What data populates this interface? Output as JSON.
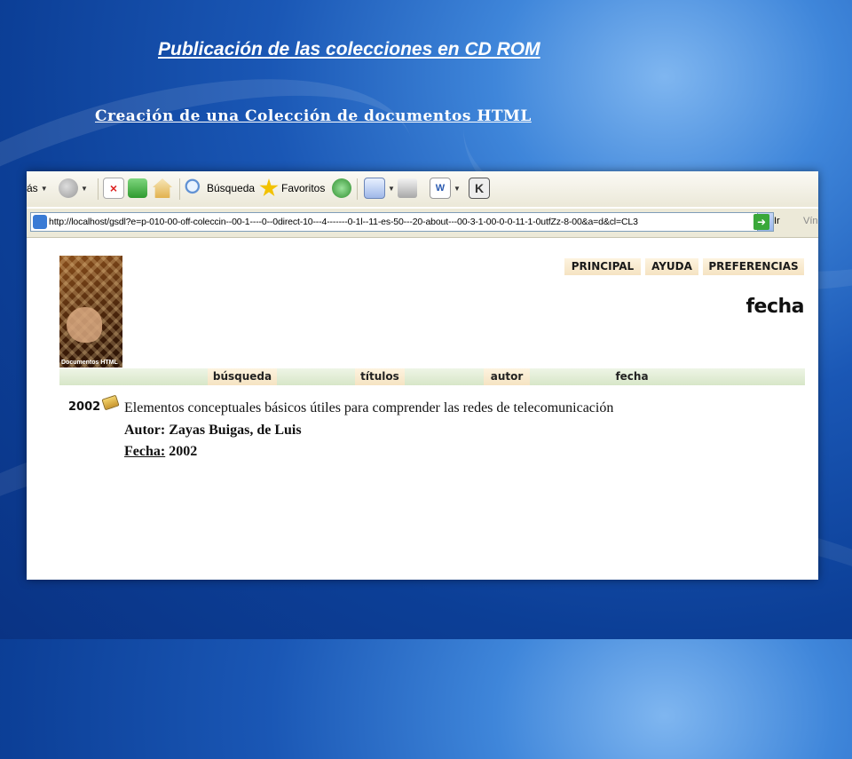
{
  "slide": {
    "title": "Publicación de las colecciones en CD ROM",
    "subtitle": "Creación de una Colección de documentos  HTML"
  },
  "browser": {
    "toolbar": {
      "back_fragment": "ás",
      "search_label": "Búsqueda",
      "favorites_label": "Favoritos"
    },
    "address": "http://localhost/gsdl?e=p-010-00-off-coleccin--00-1----0--0direct-10---4-------0-1l--11-es-50---20-about---00-3-1-00-0-0-11-1-0utfZz-8-00&a=d&cl=CL3",
    "go_label": "Ir",
    "links_label": "Vínc"
  },
  "page": {
    "logo_text": "Documentos HTML",
    "top_nav": [
      "PRINCIPAL",
      "AYUDA",
      "PREFERENCIAS"
    ],
    "heading": "fecha",
    "nav_tabs": [
      "búsqueda",
      "títulos",
      "autor",
      "fecha"
    ],
    "entry": {
      "year": "2002",
      "title": "Elementos conceptuales básicos útiles para comprender las redes de telecomunicación",
      "author": "Autor: Zayas Buigas, de Luis",
      "date_label": "Fecha:",
      "date_value": "2002"
    }
  }
}
